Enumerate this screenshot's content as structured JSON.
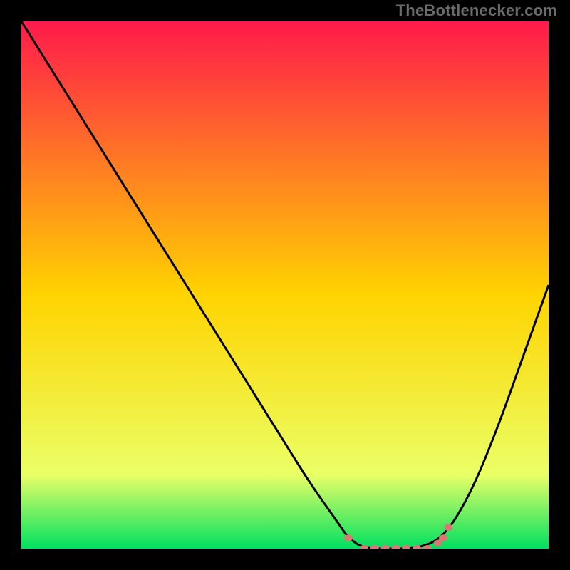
{
  "attribution": "TheBottlenecker.com",
  "colors": {
    "gradient_top": "#ff1a4b",
    "gradient_mid": "#ffd400",
    "gradient_low": "#eaff66",
    "gradient_bottom": "#00e060",
    "curve": "#000000",
    "marker": "#d77a73",
    "frame": "#000000"
  },
  "chart_data": {
    "type": "line",
    "title": "",
    "xlabel": "",
    "ylabel": "",
    "xlim": [
      0,
      100
    ],
    "ylim": [
      0,
      100
    ],
    "series": [
      {
        "name": "bottleneck-curve",
        "x": [
          0,
          5,
          10,
          15,
          20,
          25,
          30,
          35,
          40,
          45,
          50,
          55,
          60,
          62,
          65,
          70,
          75,
          80,
          85,
          90,
          95,
          100
        ],
        "values": [
          100,
          92,
          84,
          76,
          68,
          60,
          52,
          44,
          36,
          28,
          20,
          12,
          5,
          2,
          0,
          0,
          0,
          2,
          10,
          22,
          36,
          50
        ]
      }
    ],
    "markers": [
      {
        "x": 62,
        "y": 2
      },
      {
        "x": 65,
        "y": 0
      },
      {
        "x": 67,
        "y": 0
      },
      {
        "x": 69,
        "y": 0
      },
      {
        "x": 71,
        "y": 0
      },
      {
        "x": 73,
        "y": 0
      },
      {
        "x": 75,
        "y": 0
      },
      {
        "x": 77,
        "y": 0
      },
      {
        "x": 79,
        "y": 1
      },
      {
        "x": 80,
        "y": 2
      },
      {
        "x": 81,
        "y": 4
      }
    ]
  }
}
